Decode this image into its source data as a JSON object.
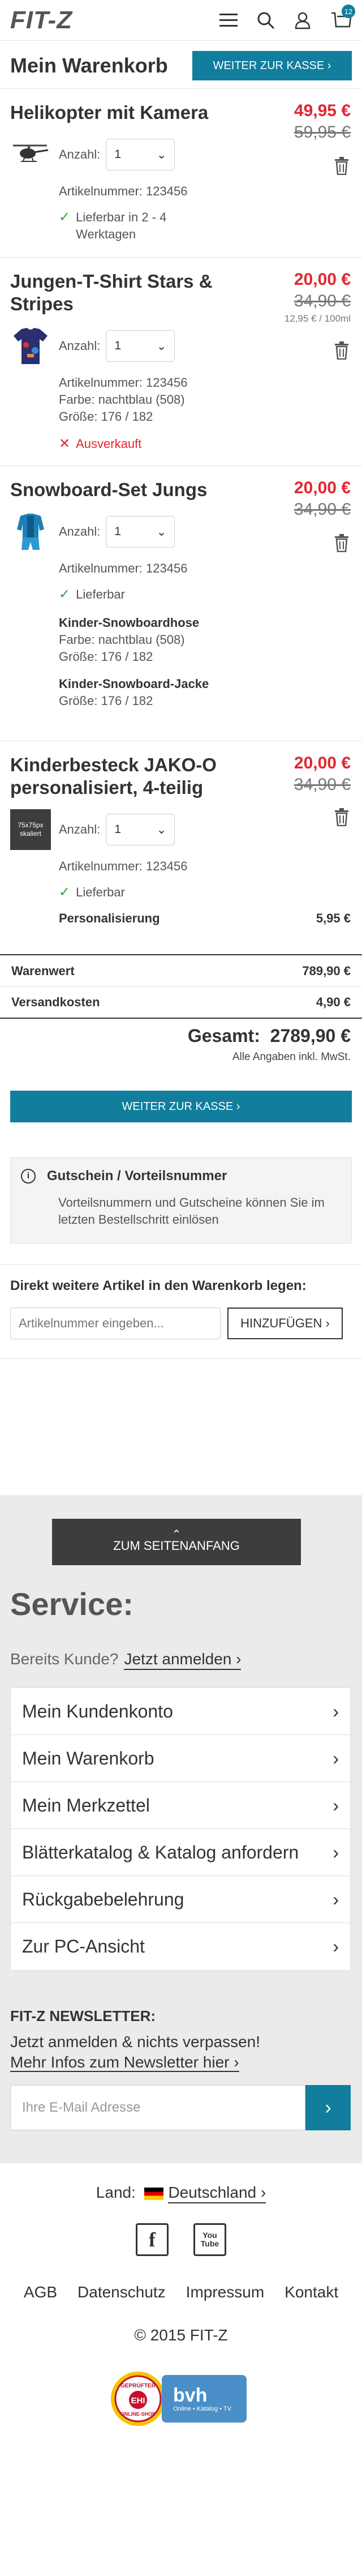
{
  "header": {
    "logo": "FIT-Z",
    "cart_count": "12"
  },
  "page": {
    "title": "Mein Warenkorb",
    "checkout_top": "WEITER ZUR KASSE ›"
  },
  "items": [
    {
      "name": "Helikopter mit Kamera",
      "price": "49,95 €",
      "old_price": "59,95 €",
      "qty_label": "Anzahl:",
      "qty": "1",
      "artnr": "Artikelnummer: 123456",
      "status": "Lieferbar in 2 - 4 Werktagen"
    },
    {
      "name": "Jungen-T-Shirt Stars & Stripes",
      "price": "20,00 €",
      "old_price": "34,90 €",
      "unit_price": "12,95 € / 100ml",
      "qty_label": "Anzahl:",
      "qty": "1",
      "artnr": "Artikelnummer: 123456",
      "farbe": "Farbe: nachtblau (508)",
      "groesse": "Größe: 176 / 182",
      "status": "Ausverkauft"
    },
    {
      "name": "Snowboard-Set Jungs",
      "price": "20,00 €",
      "old_price": "34,90 €",
      "qty_label": "Anzahl:",
      "qty": "1",
      "artnr": "Artikelnummer: 123456",
      "status": "Lieferbar",
      "sub": [
        {
          "title": "Kinder-Snowboardhose",
          "farbe": "Farbe: nachtblau (508)",
          "groesse": "Größe: 176 / 182"
        },
        {
          "title": "Kinder-Snowboard-Jacke",
          "groesse": "Größe: 176 / 182"
        }
      ]
    },
    {
      "name": "Kinderbesteck JAKO-O personalisiert, 4-teilig",
      "price": "20,00 €",
      "old_price": "34,90 €",
      "thumb_text": "75x75px skaliert",
      "qty_label": "Anzahl:",
      "qty": "1",
      "artnr": "Artikelnummer: 123456",
      "status": "Lieferbar",
      "pers_label": "Personalisierung",
      "pers_price": "5,95 €"
    }
  ],
  "summary": {
    "warenwert_label": "Warenwert",
    "warenwert": "789,90 €",
    "versand_label": "Versandkosten",
    "versand": "4,90 €",
    "gesamt_label": "Gesamt:",
    "gesamt": "2789,90 €",
    "mwst": "Alle Angaben inkl. MwSt."
  },
  "checkout_bottom": "WEITER ZUR KASSE ›",
  "voucher": {
    "title": "Gutschein / Vorteilsnummer",
    "text": "Vorteilsnummern und Gutscheine können Sie im letzten Bestellschritt einlösen"
  },
  "direct": {
    "title": "Direkt weitere Artikel in den Warenkorb legen:",
    "placeholder": "Artikelnummer eingeben...",
    "button": "HINZUFÜGEN ›"
  },
  "footer": {
    "to_top": "ZUM SEITENANFANG",
    "service_title": "Service:",
    "kunde_text": "Bereits Kunde?",
    "login_link": "Jetzt anmelden ›",
    "service_items": [
      "Mein Kundenkonto",
      "Mein Warenkorb",
      "Mein Merkzettel",
      "Blätterkatalog & Katalog anfordern",
      "Rückgabebelehrung",
      "Zur PC-Ansicht"
    ],
    "newsletter_title": "FIT-Z NEWSLETTER:",
    "newsletter_text": "Jetzt anmelden & nichts verpassen!",
    "newsletter_link": "Mehr Infos zum Newsletter hier ›",
    "email_placeholder": "Ihre E-Mail Adresse",
    "land_label": "Land:",
    "land": "Deutschland ›",
    "links": [
      "AGB",
      "Datenschutz",
      "Impressum",
      "Kontakt"
    ],
    "copyright": "© 2015 FIT-Z",
    "badge_ehi_lines": [
      "GEPRÜFTER",
      "EHI",
      "ONLINE-SHOP"
    ],
    "badge_bvh": "bvh",
    "badge_bvh_sub": "Online • Katalog • TV"
  }
}
